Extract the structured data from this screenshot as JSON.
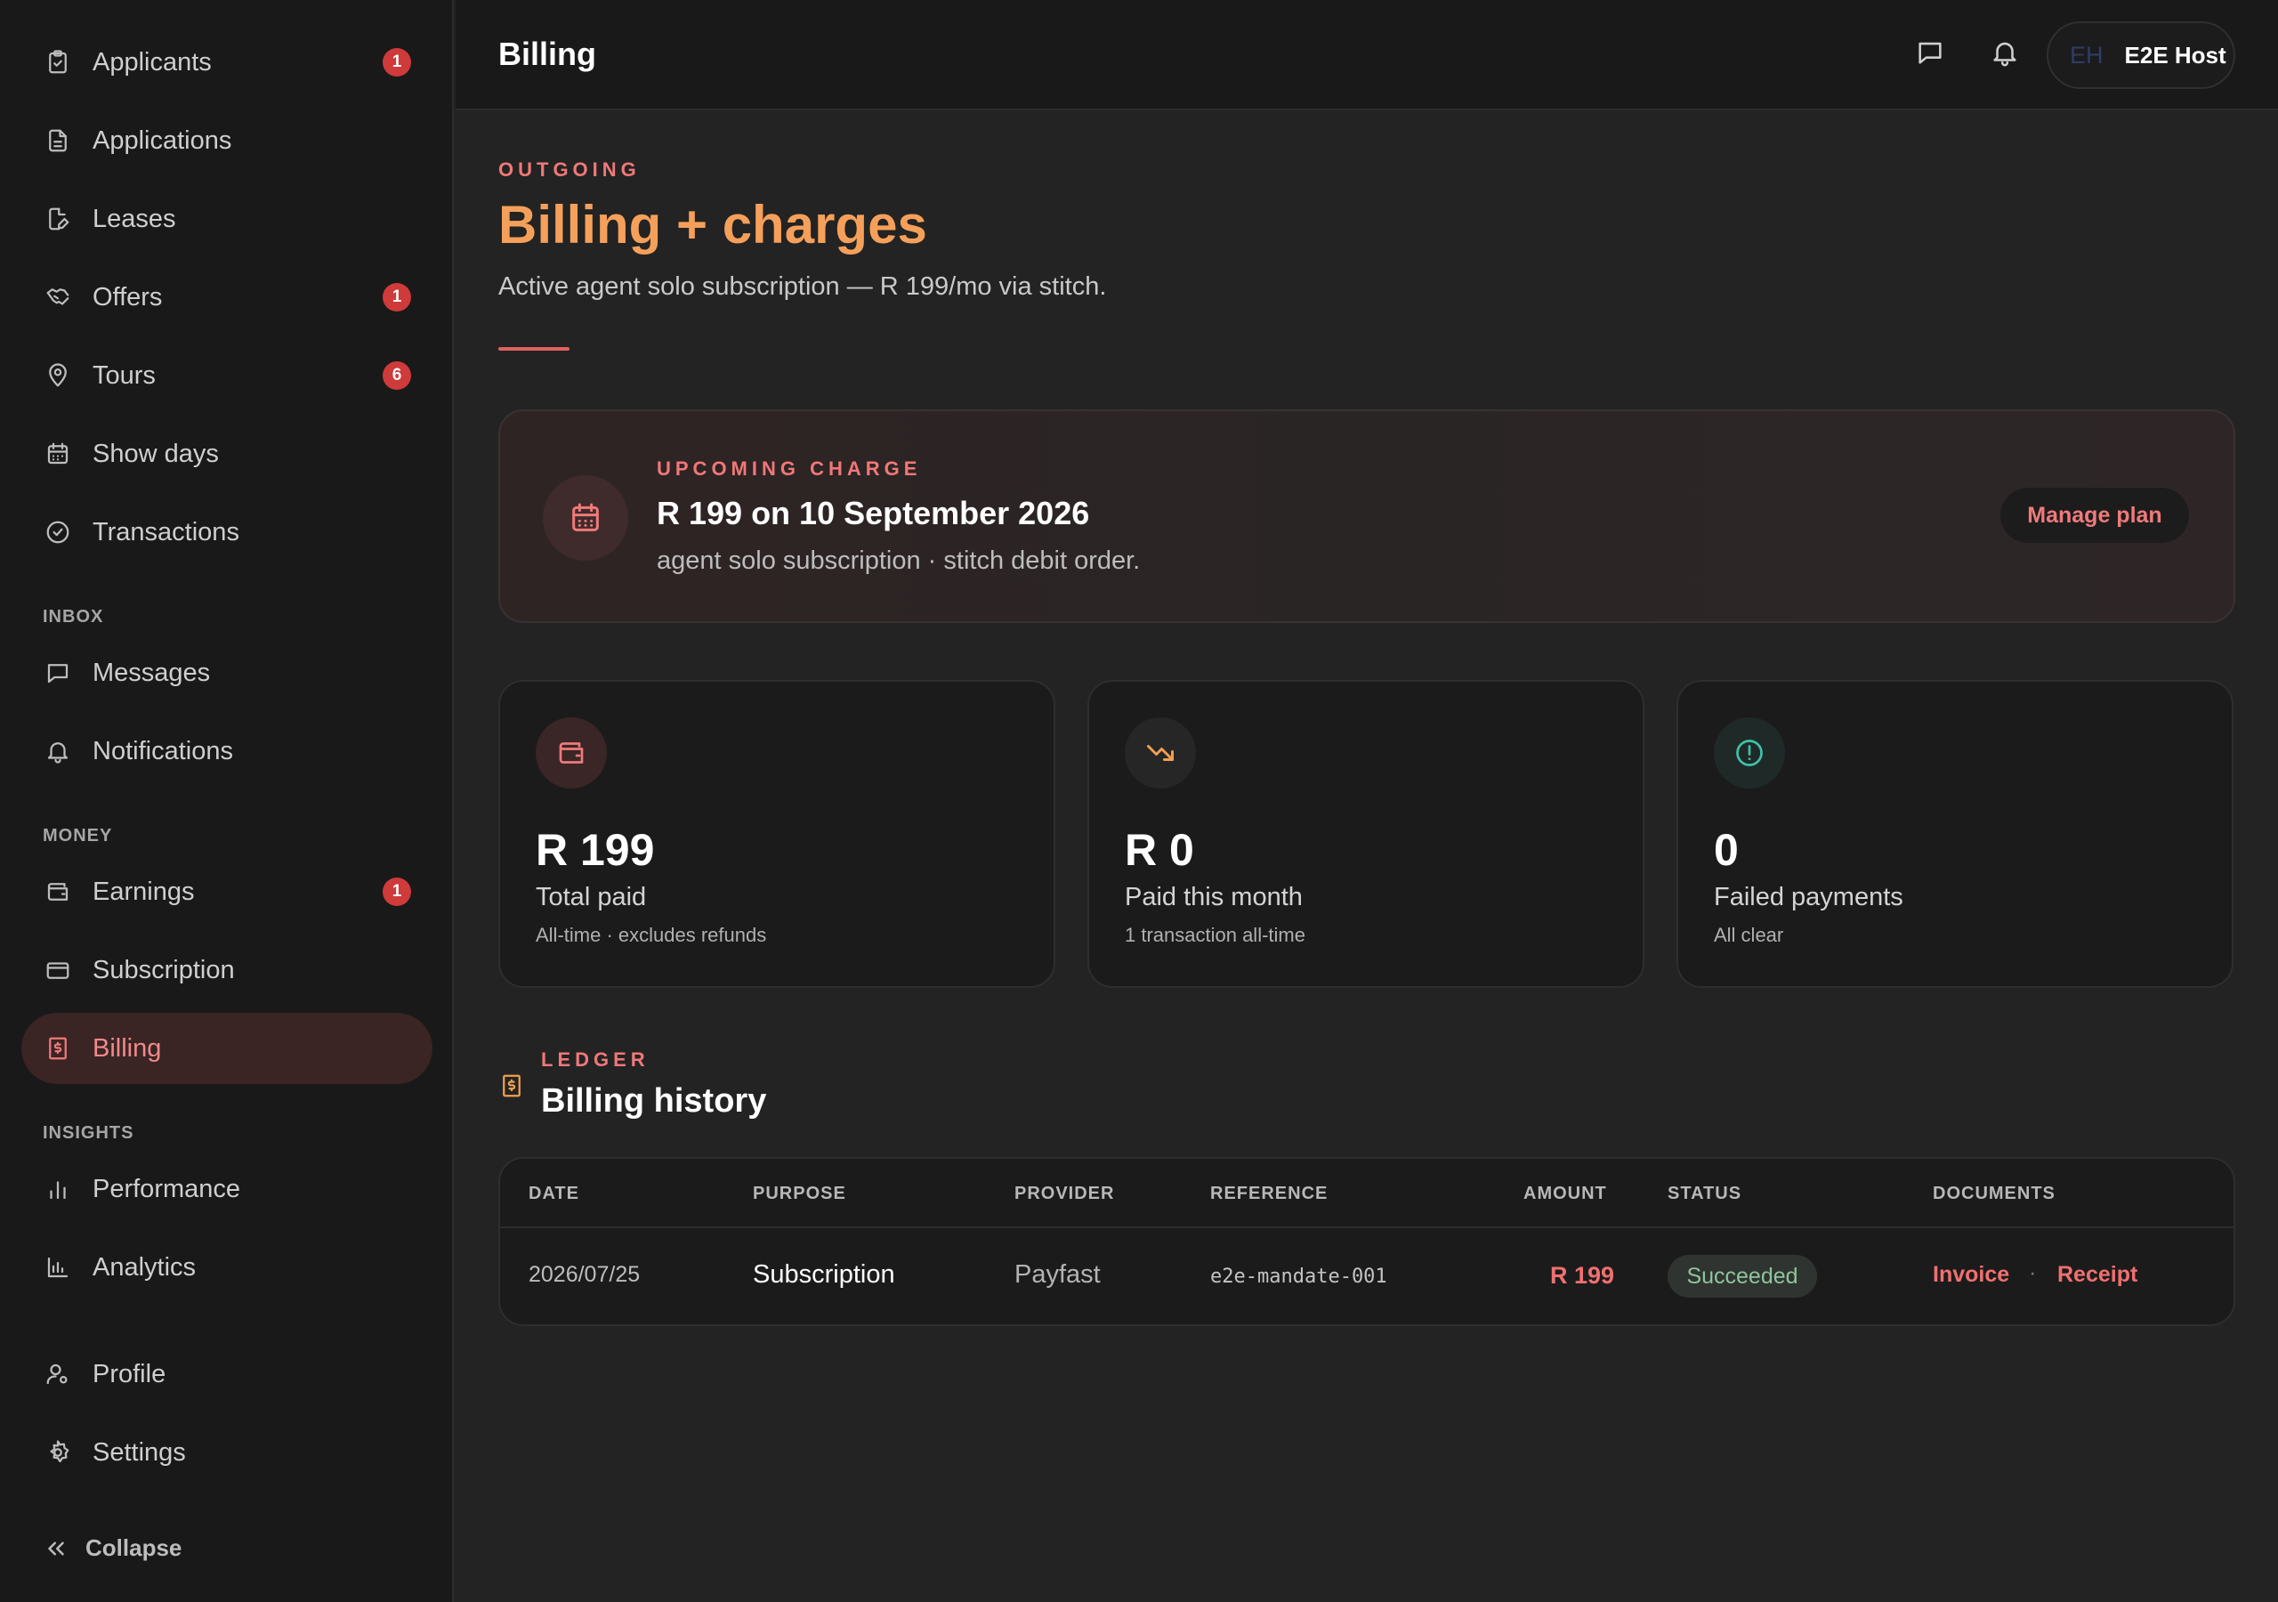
{
  "sidebar": {
    "items": [
      {
        "label": "Applicants",
        "badge": "1",
        "icon": "clipboard-icon"
      },
      {
        "label": "Applications",
        "icon": "document-icon"
      },
      {
        "label": "Leases",
        "icon": "edit-document-icon"
      },
      {
        "label": "Offers",
        "badge": "1",
        "icon": "handshake-icon"
      },
      {
        "label": "Tours",
        "badge": "6",
        "icon": "map-pin-icon"
      },
      {
        "label": "Show days",
        "icon": "calendar-icon"
      },
      {
        "label": "Transactions",
        "icon": "check-circle-icon"
      }
    ],
    "inbox_label": "INBOX",
    "inbox": [
      {
        "label": "Messages",
        "icon": "message-icon"
      },
      {
        "label": "Notifications",
        "icon": "bell-icon"
      }
    ],
    "money_label": "MONEY",
    "money": [
      {
        "label": "Earnings",
        "badge": "1",
        "icon": "wallet-icon"
      },
      {
        "label": "Subscription",
        "icon": "credit-card-icon"
      },
      {
        "label": "Billing",
        "icon": "receipt-dollar-icon",
        "active": true
      }
    ],
    "insights_label": "INSIGHTS",
    "insights": [
      {
        "label": "Performance",
        "icon": "bar-chart-icon"
      },
      {
        "label": "Analytics",
        "icon": "analytics-chart-icon"
      }
    ],
    "account": [
      {
        "label": "Profile",
        "icon": "user-settings-icon"
      },
      {
        "label": "Settings",
        "icon": "gear-icon"
      }
    ],
    "collapse_label": "Collapse"
  },
  "topbar": {
    "title": "Billing",
    "user_initials": "EH",
    "user_name": "E2E Host"
  },
  "page": {
    "eyebrow": "OUTGOING",
    "title": "Billing + charges",
    "subtitle": "Active agent solo subscription — R 199/mo via stitch."
  },
  "upcoming": {
    "eyebrow": "UPCOMING CHARGE",
    "title": "R 199 on 10 September 2026",
    "subtitle": "agent solo subscription · stitch debit order.",
    "button": "Manage plan"
  },
  "stats": [
    {
      "value": "R 199",
      "label": "Total paid",
      "sub": "All-time · excludes refunds",
      "icon": "wallet-icon",
      "color": "#f07a7a"
    },
    {
      "value": "R 0",
      "label": "Paid this month",
      "sub": "1 transaction all-time",
      "icon": "trending-down-icon",
      "color": "#f0a050"
    },
    {
      "value": "0",
      "label": "Failed payments",
      "sub": "All clear",
      "icon": "alert-circle-icon",
      "color": "#3fc1a8"
    }
  ],
  "ledger": {
    "eyebrow": "LEDGER",
    "title": "Billing history",
    "columns": [
      "DATE",
      "PURPOSE",
      "PROVIDER",
      "REFERENCE",
      "AMOUNT",
      "STATUS",
      "DOCUMENTS"
    ],
    "rows": [
      {
        "date": "2026/07/25",
        "purpose": "Subscription",
        "provider": "Payfast",
        "reference": "e2e-mandate-001",
        "amount": "R 199",
        "status": "Succeeded",
        "invoice": "Invoice",
        "separator": "·",
        "receipt": "Receipt"
      }
    ]
  },
  "colors": {
    "accent_red": "#f07070",
    "accent_orange": "#f5a05a",
    "badge_red": "#cf3a3a",
    "success_green": "#8fc49c"
  }
}
